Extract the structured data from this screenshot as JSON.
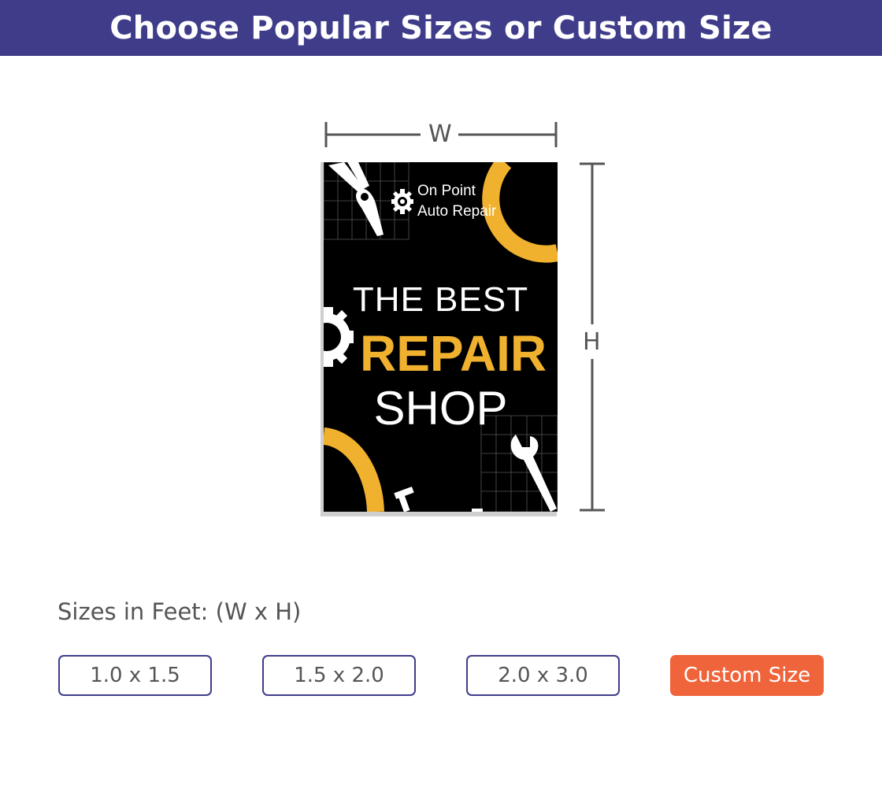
{
  "header": {
    "title": "Choose Popular Sizes or Custom Size"
  },
  "dimensions": {
    "width_label": "W",
    "height_label": "H"
  },
  "sign": {
    "brand_line1": "On Point",
    "brand_line2": "Auto Repair",
    "headline_line1": "THE BEST",
    "headline_line2": "REPAIR",
    "headline_line3": "SHOP",
    "colors": {
      "background": "#000000",
      "accent": "#f0b12e",
      "text": "#ffffff"
    },
    "icons": [
      "gear-icon",
      "pliers-icon",
      "wrench-icon",
      "bolt-icon"
    ]
  },
  "sizes": {
    "label": "Sizes in Feet: (W x H)",
    "options": [
      "1.0 x 1.5",
      "1.5 x 2.0",
      "2.0 x 3.0"
    ],
    "custom_label": "Custom Size"
  },
  "colors": {
    "brand": "#3f3d8a",
    "cta": "#ef643a",
    "text_gray": "#555555"
  }
}
